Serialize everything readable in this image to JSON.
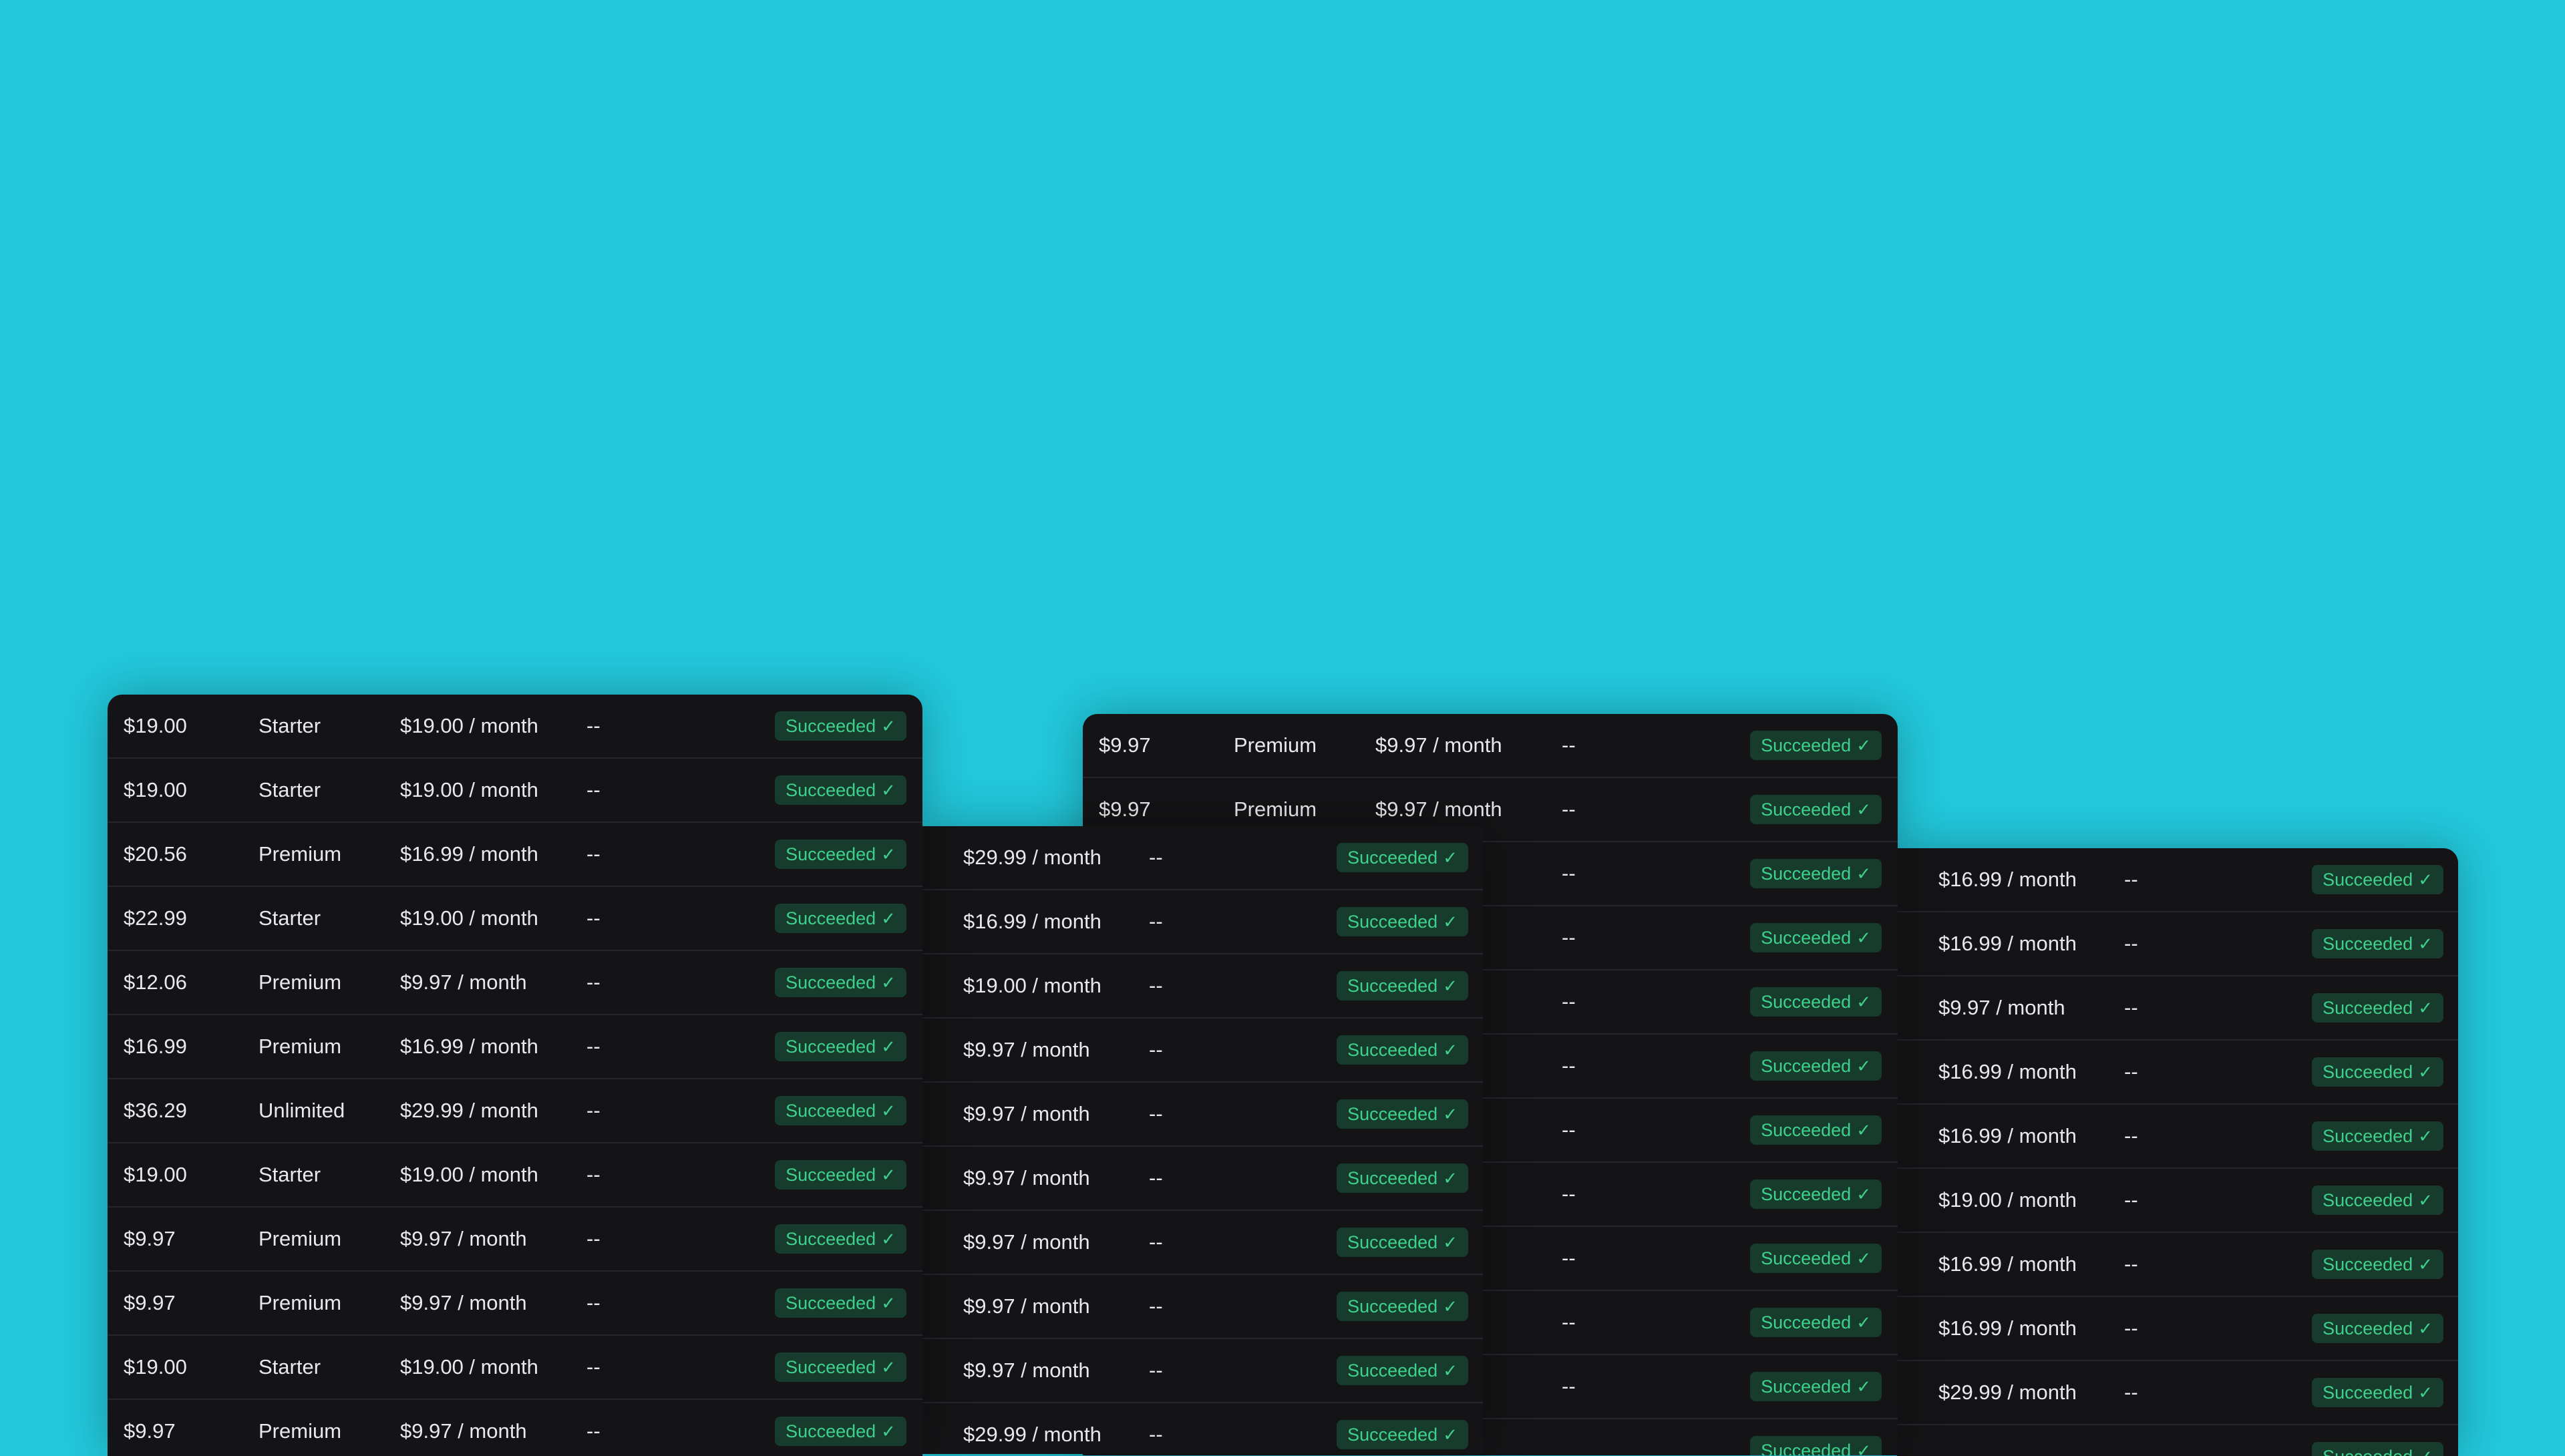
{
  "status_label": "Succeeded",
  "panels": [
    {
      "name": "payments-panel-1",
      "rows": [
        {
          "amount": "$19.00",
          "plan": "Starter",
          "rate": "$19.00 / month",
          "discount": "--"
        },
        {
          "amount": "$19.00",
          "plan": "Starter",
          "rate": "$19.00 / month",
          "discount": "--"
        },
        {
          "amount": "$20.56",
          "plan": "Premium",
          "rate": "$16.99 / month",
          "discount": "--"
        },
        {
          "amount": "$22.99",
          "plan": "Starter",
          "rate": "$19.00 / month",
          "discount": "--"
        },
        {
          "amount": "$12.06",
          "plan": "Premium",
          "rate": "$9.97 / month",
          "discount": "--"
        },
        {
          "amount": "$16.99",
          "plan": "Premium",
          "rate": "$16.99 / month",
          "discount": "--"
        },
        {
          "amount": "$36.29",
          "plan": "Unlimited",
          "rate": "$29.99 / month",
          "discount": "--"
        },
        {
          "amount": "$19.00",
          "plan": "Starter",
          "rate": "$19.00 / month",
          "discount": "--"
        },
        {
          "amount": "$9.97",
          "plan": "Premium",
          "rate": "$9.97 / month",
          "discount": "--"
        },
        {
          "amount": "$9.97",
          "plan": "Premium",
          "rate": "$9.97 / month",
          "discount": "--"
        },
        {
          "amount": "$19.00",
          "plan": "Starter",
          "rate": "$19.00 / month",
          "discount": "--"
        },
        {
          "amount": "$9.97",
          "plan": "Premium",
          "rate": "$9.97 / month",
          "discount": "--"
        }
      ]
    },
    {
      "name": "payments-panel-2",
      "rows": [
        {
          "rate": "$29.99 / month",
          "discount": "--"
        },
        {
          "rate": "$16.99 / month",
          "discount": "--"
        },
        {
          "rate": "$19.00 / month",
          "discount": "--"
        },
        {
          "rate": "$9.97 / month",
          "discount": "--"
        },
        {
          "rate": "$9.97 / month",
          "discount": "--"
        },
        {
          "rate": "$9.97 / month",
          "discount": "--"
        },
        {
          "rate": "$9.97 / month",
          "discount": "--"
        },
        {
          "rate": "$9.97 / month",
          "discount": "--"
        },
        {
          "rate": "$9.97 / month",
          "discount": "--"
        },
        {
          "rate": "$29.99 / month",
          "discount": "--"
        }
      ]
    },
    {
      "name": "payments-panel-3",
      "rows": [
        {
          "amount": "$9.97",
          "plan": "Premium",
          "rate": "$9.97 / month",
          "discount": "--"
        },
        {
          "amount": "$9.97",
          "plan": "Premium",
          "rate": "$9.97 / month",
          "discount": "--"
        },
        {
          "amount": "",
          "plan": "",
          "rate": "",
          "discount": "--"
        },
        {
          "amount": "",
          "plan": "",
          "rate": "",
          "discount": "--"
        },
        {
          "amount": "",
          "plan": "",
          "rate": "",
          "discount": "--"
        },
        {
          "amount": "",
          "plan": "",
          "rate": "",
          "discount": "--"
        },
        {
          "amount": "",
          "plan": "",
          "rate": "",
          "discount": "--"
        },
        {
          "amount": "",
          "plan": "",
          "rate": "",
          "discount": "--"
        },
        {
          "amount": "",
          "plan": "",
          "rate": "",
          "discount": "--"
        },
        {
          "amount": "",
          "plan": "",
          "rate": "",
          "discount": "--"
        },
        {
          "amount": "",
          "plan": "",
          "rate": "",
          "discount": "--"
        },
        {
          "amount": "",
          "plan": "",
          "rate": "",
          "discount": ""
        }
      ]
    },
    {
      "name": "payments-panel-4",
      "rows": [
        {
          "rate": "$16.99 / month",
          "discount": "--"
        },
        {
          "rate": "$16.99 / month",
          "discount": "--"
        },
        {
          "rate": "$9.97 / month",
          "discount": "--"
        },
        {
          "rate": "$16.99 / month",
          "discount": "--"
        },
        {
          "rate": "$16.99 / month",
          "discount": "--"
        },
        {
          "rate": "$19.00 / month",
          "discount": "--"
        },
        {
          "rate": "$16.99 / month",
          "discount": "--"
        },
        {
          "rate": "$16.99 / month",
          "discount": "--"
        },
        {
          "rate": "$29.99 / month",
          "discount": "--"
        },
        {
          "rate": "",
          "discount": ""
        }
      ]
    }
  ]
}
